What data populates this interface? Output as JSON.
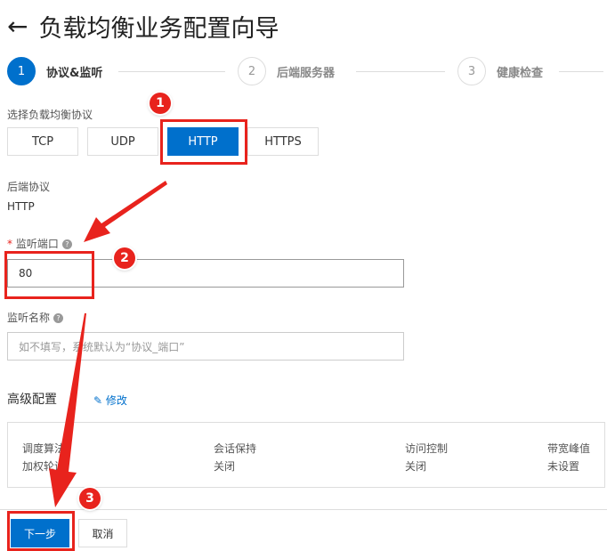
{
  "header": {
    "title": "负载均衡业务配置向导",
    "back_icon": "arrow-left-icon"
  },
  "steps": [
    {
      "num": "1",
      "label": "协议&监听",
      "active": true
    },
    {
      "num": "2",
      "label": "后端服务器",
      "active": false
    },
    {
      "num": "3",
      "label": "健康检查",
      "active": false
    }
  ],
  "protocol": {
    "label": "选择负载均衡协议",
    "options": [
      "TCP",
      "UDP",
      "HTTP",
      "HTTPS"
    ],
    "selected": "HTTP"
  },
  "backend": {
    "label": "后端协议",
    "value": "HTTP"
  },
  "port": {
    "required": "*",
    "label": "监听端口",
    "value": "80"
  },
  "name": {
    "label": "监听名称",
    "placeholder": "如不填写，系统默认为“协议_端口”"
  },
  "advanced": {
    "label": "高级配置",
    "edit": "修改",
    "columns": [
      {
        "k": "调度算法",
        "v": "加权轮询"
      },
      {
        "k": "会话保持",
        "v": "关闭"
      },
      {
        "k": "访问控制",
        "v": "关闭"
      },
      {
        "k": "带宽峰值",
        "v": "未设置"
      }
    ]
  },
  "footer": {
    "next": "下一步",
    "cancel": "取消"
  },
  "annotations": {
    "b1": "1",
    "b2": "2",
    "b3": "3"
  },
  "colors": {
    "primary": "#0070cc",
    "annotation": "#e8231d"
  }
}
